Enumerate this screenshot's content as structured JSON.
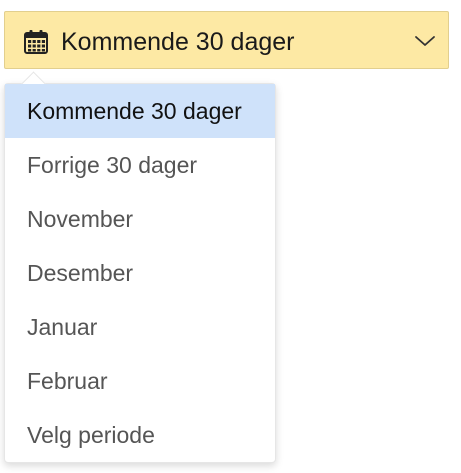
{
  "period_select": {
    "selected_label": "Kommende 30 dager",
    "icon": "calendar-icon",
    "chevron": "chevron-down-icon",
    "background_color": "#fde9a4"
  },
  "dropdown": {
    "highlight_color": "#cfe2fa",
    "options": [
      {
        "label": "Kommende 30 dager",
        "active": true
      },
      {
        "label": "Forrige 30 dager",
        "active": false
      },
      {
        "label": "November",
        "active": false
      },
      {
        "label": "Desember",
        "active": false
      },
      {
        "label": "Januar",
        "active": false
      },
      {
        "label": "Februar",
        "active": false
      },
      {
        "label": "Velg periode",
        "active": false
      }
    ]
  }
}
